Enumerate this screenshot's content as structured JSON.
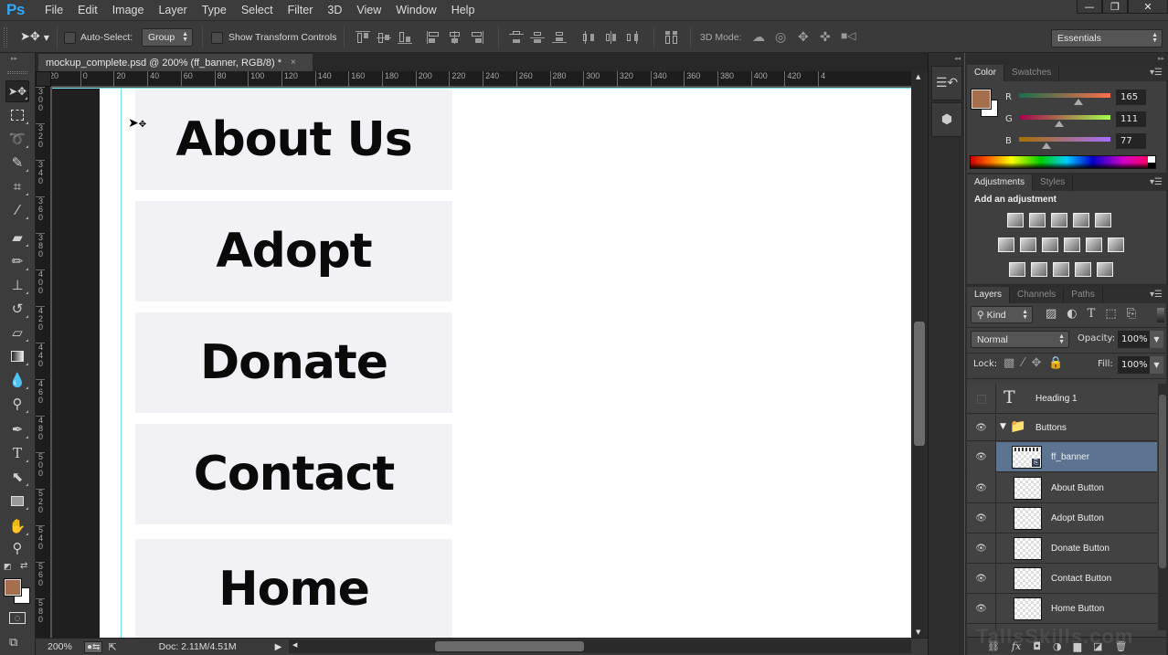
{
  "app": {
    "logo": "Ps"
  },
  "menu": [
    "File",
    "Edit",
    "Image",
    "Layer",
    "Type",
    "Select",
    "Filter",
    "3D",
    "View",
    "Window",
    "Help"
  ],
  "window_controls": {
    "minimize": "—",
    "restore": "❐",
    "close": "✕"
  },
  "options_bar": {
    "auto_select_label": "Auto-Select:",
    "auto_select_checked": false,
    "auto_select_target": "Group",
    "show_transform_label": "Show Transform Controls",
    "show_transform_checked": false,
    "mode_3d_label": "3D Mode:",
    "workspace": "Essentials"
  },
  "document_tab": {
    "title": "mockup_complete.psd @ 200% (ff_banner, RGB/8) *",
    "close": "×"
  },
  "ruler_h": [
    "20",
    "0",
    "20",
    "40",
    "60",
    "80",
    "100",
    "120",
    "140",
    "160",
    "180",
    "200",
    "220",
    "240",
    "260",
    "280",
    "300",
    "320",
    "340",
    "360",
    "380",
    "400",
    "420",
    "4"
  ],
  "ruler_v": [
    "300",
    "320",
    "340",
    "360",
    "380",
    "400",
    "420",
    "440",
    "460",
    "480",
    "500",
    "520",
    "540",
    "560",
    "580"
  ],
  "canvas": {
    "buttons": [
      "About Us",
      "Adopt",
      "Donate",
      "Contact",
      "Home"
    ]
  },
  "status": {
    "zoom": "200%",
    "doc": "Doc: 2.11M/4.51M"
  },
  "color_panel": {
    "tabs": [
      "Color",
      "Swatches"
    ],
    "foreground": "#a56f4d",
    "background": "#ffffff",
    "channels": [
      {
        "label": "R",
        "value": "165",
        "fraction": 0.647
      },
      {
        "label": "G",
        "value": "111",
        "fraction": 0.435
      },
      {
        "label": "B",
        "value": "77",
        "fraction": 0.302
      }
    ]
  },
  "adjustments_panel": {
    "tabs": [
      "Adjustments",
      "Styles"
    ],
    "heading": "Add an adjustment",
    "rows": [
      [
        "brightness-contrast",
        "levels",
        "curves",
        "exposure",
        "vibrance"
      ],
      [
        "hue-saturation",
        "color-balance",
        "black-white",
        "photo-filter",
        "channel-mixer",
        "color-lookup"
      ],
      [
        "invert",
        "posterize",
        "threshold",
        "selective-color",
        "gradient-map"
      ]
    ]
  },
  "layers_panel": {
    "tabs": [
      "Layers",
      "Channels",
      "Paths"
    ],
    "filter_kind": "Kind",
    "blend_mode": "Normal",
    "opacity_label": "Opacity:",
    "opacity": "100%",
    "lock_label": "Lock:",
    "fill_label": "Fill:",
    "fill": "100%",
    "layers": [
      {
        "name": "Heading 1",
        "type": "text",
        "visible": false,
        "selected": false
      },
      {
        "name": "Buttons",
        "type": "group",
        "visible": true,
        "selected": false
      },
      {
        "name": "ff_banner",
        "type": "smart-object",
        "visible": true,
        "selected": true
      },
      {
        "name": "About Button",
        "type": "pixel",
        "visible": true,
        "selected": false
      },
      {
        "name": "Adopt Button",
        "type": "pixel",
        "visible": true,
        "selected": false
      },
      {
        "name": "Donate Button",
        "type": "pixel",
        "visible": true,
        "selected": false
      },
      {
        "name": "Contact Button",
        "type": "pixel",
        "visible": true,
        "selected": false
      },
      {
        "name": "Home Button",
        "type": "pixel",
        "visible": true,
        "selected": false
      }
    ]
  },
  "watermark": "TallsSkills.com"
}
